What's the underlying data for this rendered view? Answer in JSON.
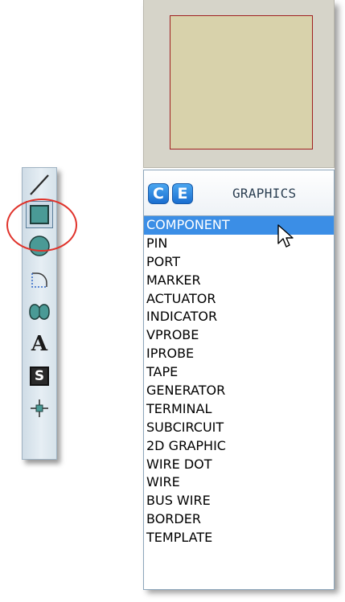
{
  "toolbar": {
    "tools": [
      {
        "icon": "line-icon"
      },
      {
        "icon": "box-icon",
        "selected": true
      },
      {
        "icon": "circle-icon"
      },
      {
        "icon": "arc-icon"
      },
      {
        "icon": "closed-path-icon"
      },
      {
        "icon": "text-icon",
        "glyph": "A"
      },
      {
        "icon": "symbol-icon",
        "glyph": "S"
      },
      {
        "icon": "marker-icon"
      }
    ]
  },
  "selector": {
    "mode_c": "C",
    "mode_e": "E",
    "title": "GRAPHICS",
    "selected_index": 0,
    "items": [
      {
        "label": "COMPONENT"
      },
      {
        "label": "PIN"
      },
      {
        "label": "PORT"
      },
      {
        "label": "MARKER"
      },
      {
        "label": "ACTUATOR"
      },
      {
        "label": "INDICATOR"
      },
      {
        "label": "VPROBE"
      },
      {
        "label": "IPROBE"
      },
      {
        "label": "TAPE"
      },
      {
        "label": "GENERATOR"
      },
      {
        "label": "TERMINAL"
      },
      {
        "label": "SUBCIRCUIT"
      },
      {
        "label": "2D GRAPHIC"
      },
      {
        "label": "WIRE DOT"
      },
      {
        "label": "WIRE"
      },
      {
        "label": "BUS WIRE"
      },
      {
        "label": "BORDER"
      },
      {
        "label": "TEMPLATE"
      }
    ]
  },
  "colors": {
    "selection": "#3b8ee6",
    "preview_border": "#a02020",
    "highlight_ring": "#e0332b",
    "button_blue": "#1a6ed0"
  }
}
